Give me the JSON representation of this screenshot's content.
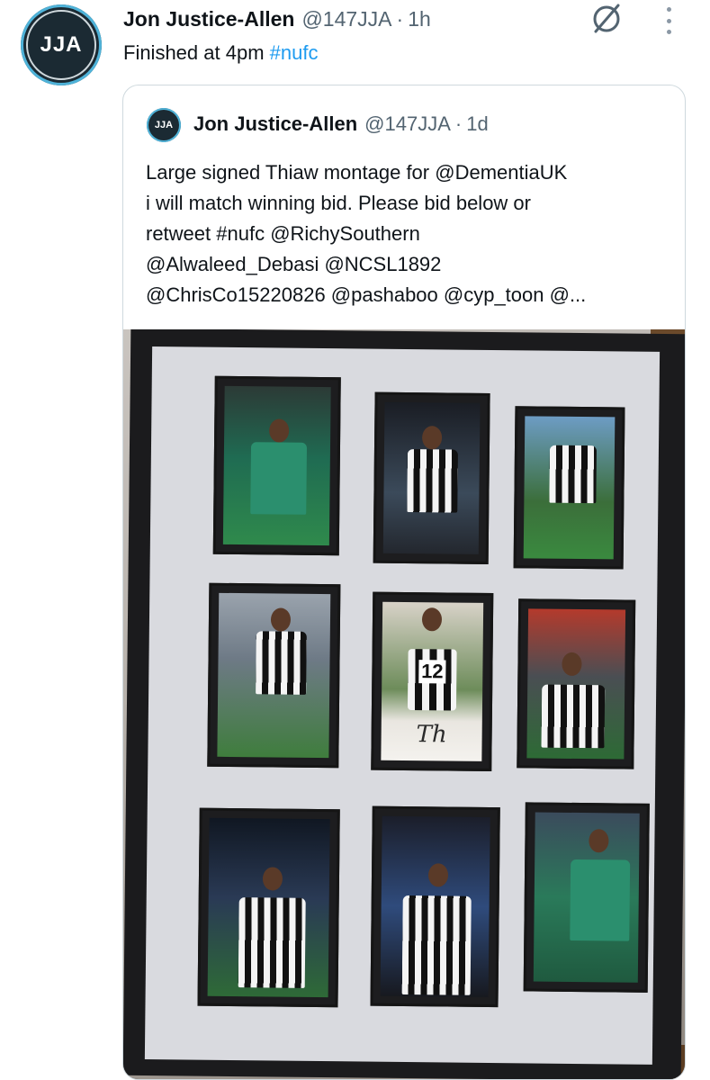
{
  "tweet": {
    "avatar_text": "JJA",
    "name": "Jon Justice-Allen",
    "handle": "@147JJA",
    "separator": "·",
    "time": "1h",
    "text_plain": "Finished at 4pm ",
    "hashtag": "#nufc"
  },
  "quote": {
    "avatar_text": "JJA",
    "name": "Jon Justice-Allen",
    "handle": "@147JJA",
    "separator": "·",
    "time": "1d",
    "lines": [
      "Large signed Thiaw montage for @DementiaUK",
      "i will match winning bid. Please bid below or",
      "retweet #nufc @RichySouthern",
      "@Alwaleed_Debasi @NCSL1892",
      "@ChrisCo15220826 @pashaboo @cyp_toon @..."
    ]
  },
  "photo": {
    "jersey_number": "12",
    "signature": "Th"
  },
  "icons": {
    "grok": "grok-icon",
    "more": "more-vertical-icon"
  },
  "colors": {
    "link": "#1d9bf0",
    "secondary_text": "#536471",
    "border": "#cfd9de"
  }
}
